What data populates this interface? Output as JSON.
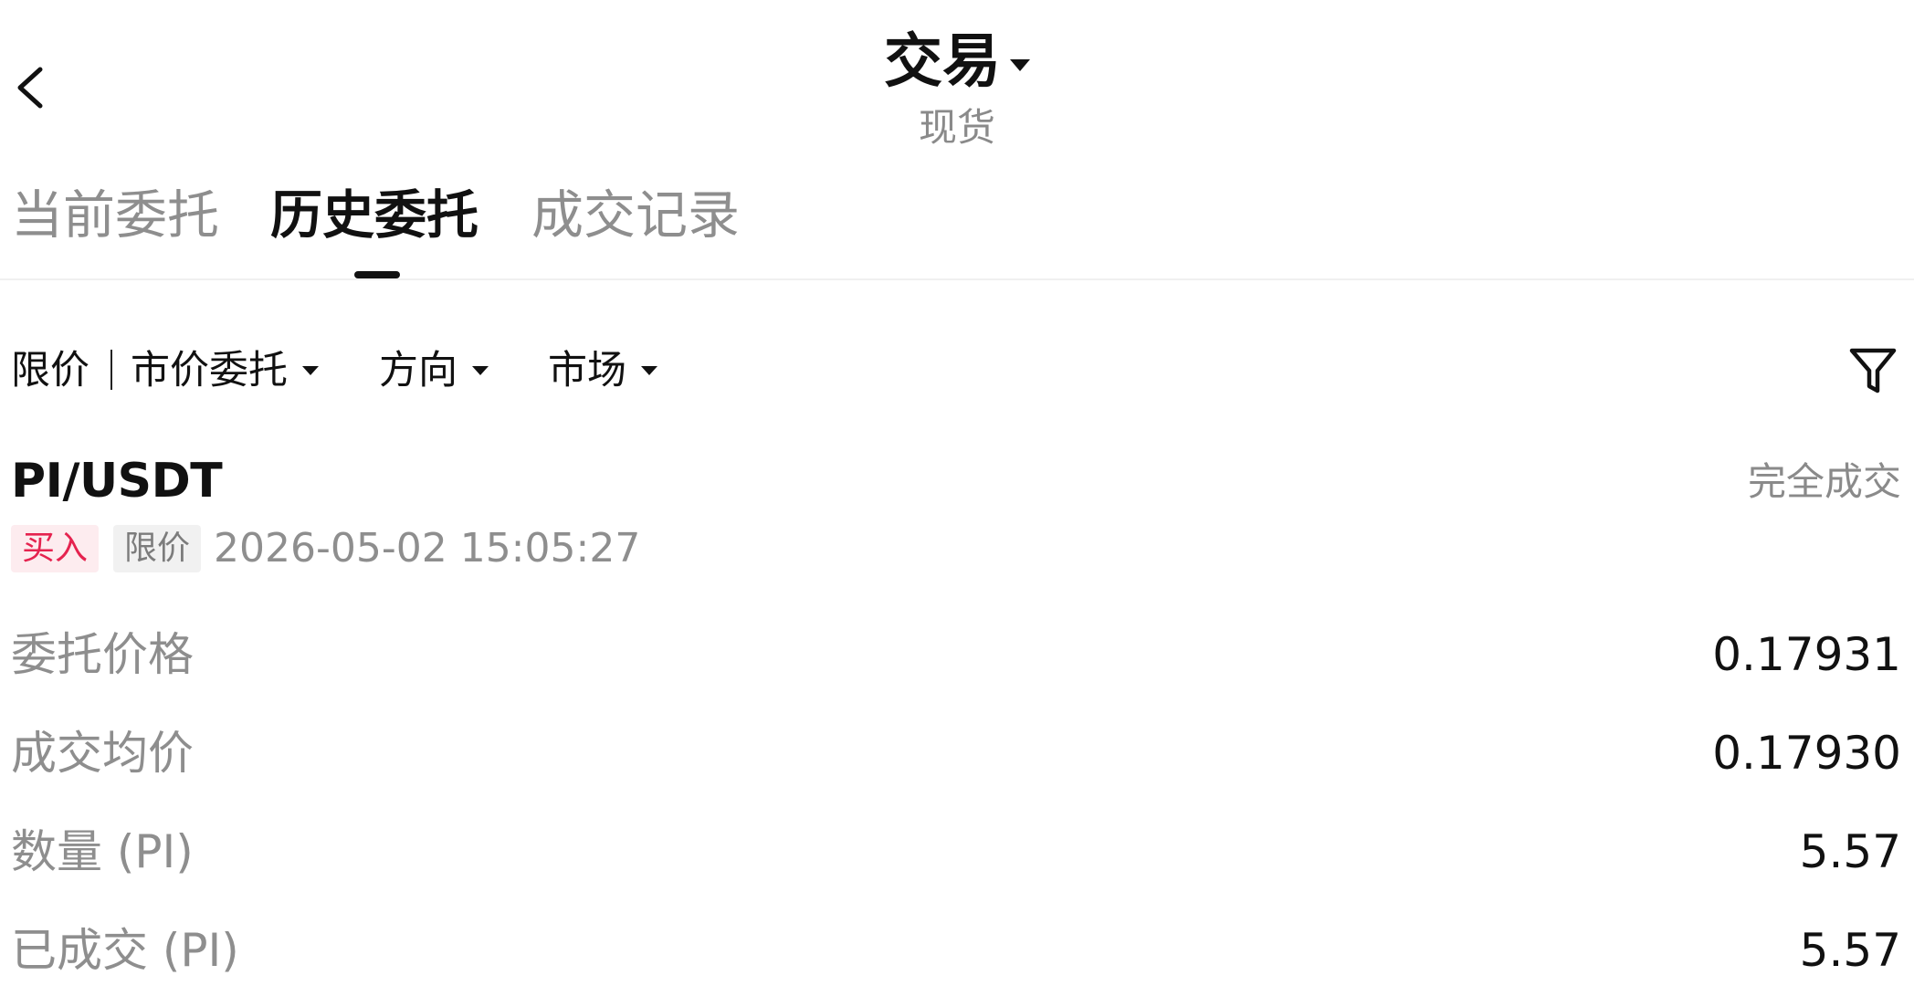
{
  "header": {
    "title": "交易",
    "subtitle": "现货"
  },
  "tabs": [
    {
      "label": "当前委托",
      "active": false
    },
    {
      "label": "历史委托",
      "active": true
    },
    {
      "label": "成交记录",
      "active": false
    }
  ],
  "filters": {
    "limit": "限价",
    "market_order": "市价委托",
    "direction": "方向",
    "market": "市场"
  },
  "order": {
    "pair": "PI/USDT",
    "status": "完全成交",
    "side": "买入",
    "type": "限价",
    "time": "2026-05-02 15:05:27",
    "rows": [
      {
        "label": "委托价格",
        "value": "0.17931"
      },
      {
        "label": "成交均价",
        "value": "0.17930"
      },
      {
        "label": "数量 (PI)",
        "value": "5.57"
      },
      {
        "label": "已成交 (PI)",
        "value": "5.57"
      }
    ]
  },
  "colors": {
    "buy": "#e5234f",
    "buy_bg": "#fdecef",
    "muted": "#8e8e8e",
    "text": "#111111"
  },
  "icons": {
    "back": "chevron-left-icon",
    "filter": "funnel-icon"
  }
}
